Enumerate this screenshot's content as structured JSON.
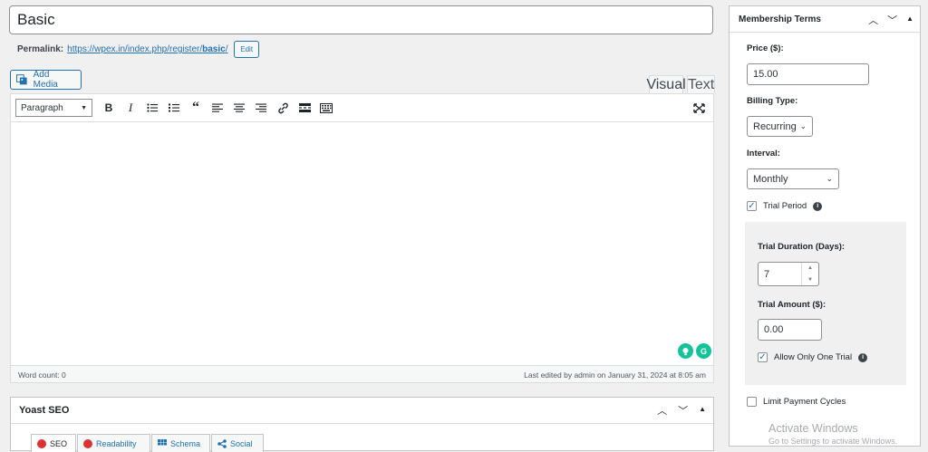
{
  "title": {
    "value": "Basic"
  },
  "permalink": {
    "label": "Permalink:",
    "url_base": "https://wpex.in/index.php/register/",
    "slug": "basic",
    "url_end": "/",
    "edit_label": "Edit"
  },
  "add_media_label": "Add Media",
  "editor_tabs": {
    "visual": "Visual",
    "text": "Text"
  },
  "toolbar": {
    "format": "Paragraph",
    "icons": [
      "bold-icon",
      "italic-icon",
      "bullet-list-icon",
      "numbered-list-icon",
      "blockquote-icon",
      "align-left-icon",
      "align-center-icon",
      "align-right-icon",
      "link-icon",
      "read-more-icon",
      "toolbar-toggle-icon"
    ],
    "bold": "B",
    "italic": "I"
  },
  "statusbar": {
    "word_count": "Word count: 0",
    "last_edited": "Last edited by admin on January 31, 2024 at 8:05 am"
  },
  "yoast": {
    "title": "Yoast SEO",
    "tabs": [
      "SEO",
      "Readability",
      "Schema",
      "Social"
    ]
  },
  "membership": {
    "title": "Membership Terms",
    "price_label": "Price ($):",
    "price_value": "15.00",
    "billing_label": "Billing Type:",
    "billing_value": "Recurring",
    "interval_label": "Interval:",
    "interval_value": "Monthly",
    "trial_period_label": "Trial Period",
    "trial_period_checked": true,
    "trial_duration_label": "Trial Duration (Days):",
    "trial_duration_value": "7",
    "trial_amount_label": "Trial Amount ($):",
    "trial_amount_value": "0.00",
    "one_trial_label": "Allow Only One Trial",
    "one_trial_checked": true,
    "limit_cycles_label": "Limit Payment Cycles",
    "limit_cycles_checked": false
  },
  "watermark": {
    "line1": "Activate Windows",
    "line2": "Go to Settings to activate Windows."
  },
  "colors": {
    "accent": "#2271b1",
    "error": "#dc3232",
    "grammarly": "#15c39a"
  }
}
